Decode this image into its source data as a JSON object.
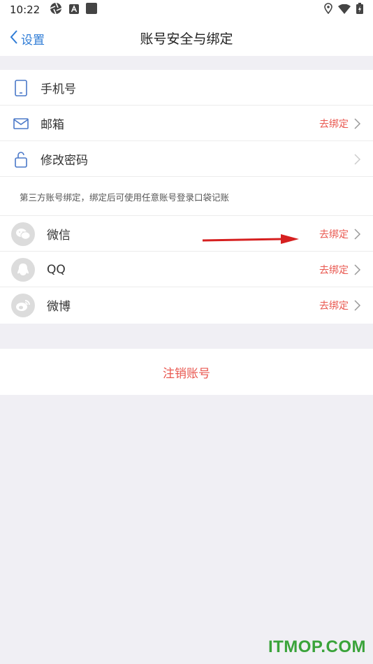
{
  "status_bar": {
    "time": "10:22"
  },
  "nav": {
    "back_label": "设置",
    "title": "账号安全与绑定"
  },
  "account_rows": [
    {
      "label": "手机号",
      "action": "",
      "icon": "phone-icon"
    },
    {
      "label": "邮箱",
      "action": "去绑定",
      "icon": "mail-icon"
    },
    {
      "label": "修改密码",
      "action": "",
      "icon": "lock-icon"
    }
  ],
  "third_party": {
    "description": "第三方账号绑定，绑定后可使用任意账号登录口袋记账",
    "rows": [
      {
        "label": "微信",
        "action": "去绑定",
        "icon": "wechat-icon"
      },
      {
        "label": "QQ",
        "action": "去绑定",
        "icon": "qq-icon"
      },
      {
        "label": "微博",
        "action": "去绑定",
        "icon": "weibo-icon"
      }
    ]
  },
  "cancel_account": {
    "label": "注销账号"
  },
  "watermark": {
    "text": "ITMOP.COM"
  },
  "colors": {
    "accent_blue": "#2f7cd6",
    "action_red": "#e9574f",
    "background": "#f0eff4"
  }
}
